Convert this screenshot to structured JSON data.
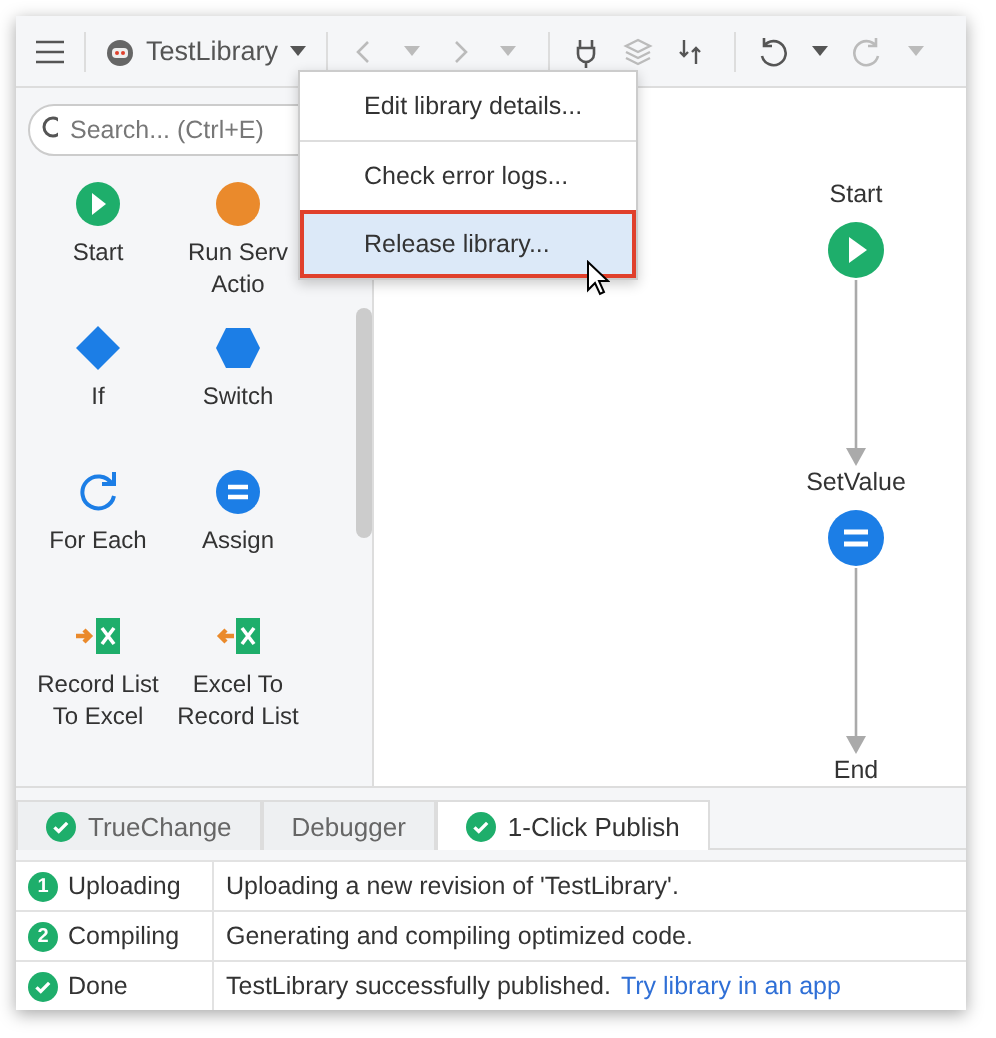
{
  "toolbar": {
    "library": "TestLibrary",
    "buttons": [
      {
        "kind": "back",
        "disabled": true
      },
      {
        "kind": "forward",
        "disabled": true
      },
      {
        "kind": "plug",
        "disabled": false
      },
      {
        "kind": "layers",
        "disabled": true
      },
      {
        "kind": "sort",
        "disabled": false
      },
      {
        "kind": "undo",
        "disabled": false
      },
      {
        "kind": "redo",
        "disabled": true
      }
    ]
  },
  "search": {
    "placeholder": "Search... (Ctrl+E)"
  },
  "toolbox": [
    {
      "kind": "start",
      "lines": [
        "Start"
      ]
    },
    {
      "kind": "server",
      "lines": [
        "Run Serv",
        "Actio"
      ]
    },
    {
      "kind": "if",
      "lines": [
        "If"
      ]
    },
    {
      "kind": "switch",
      "lines": [
        "Switch"
      ]
    },
    {
      "kind": "foreach",
      "lines": [
        "For Each"
      ]
    },
    {
      "kind": "assign",
      "lines": [
        "Assign"
      ]
    },
    {
      "kind": "to-excel",
      "lines": [
        "Record List",
        "To Excel"
      ]
    },
    {
      "kind": "from-excel",
      "lines": [
        "Excel To",
        "Record List"
      ]
    }
  ],
  "menu": [
    {
      "label": "Edit library details...",
      "selected": false
    },
    {
      "label": "Check error logs...",
      "selected": false
    },
    {
      "label": "Release library...",
      "selected": true
    }
  ],
  "flow": [
    {
      "kind": "start",
      "label": "Start"
    },
    {
      "kind": "assign",
      "label": "SetValue"
    },
    {
      "kind": "end",
      "label": "End"
    }
  ],
  "tabs": [
    {
      "label": "TrueChange",
      "done": true,
      "selected": false
    },
    {
      "label": "Debugger",
      "done": false,
      "selected": false
    },
    {
      "label": "1-Click Publish",
      "done": true,
      "selected": true
    }
  ],
  "steps": [
    {
      "badge": "1",
      "kind": "number",
      "name": "Uploading",
      "message": "Uploading a new revision of 'TestLibrary'."
    },
    {
      "badge": "2",
      "kind": "number",
      "name": "Compiling",
      "message": "Generating and compiling optimized code."
    },
    {
      "kind": "check",
      "name": "Done",
      "message": "TestLibrary successfully published.",
      "link": "Try library in an app"
    }
  ]
}
